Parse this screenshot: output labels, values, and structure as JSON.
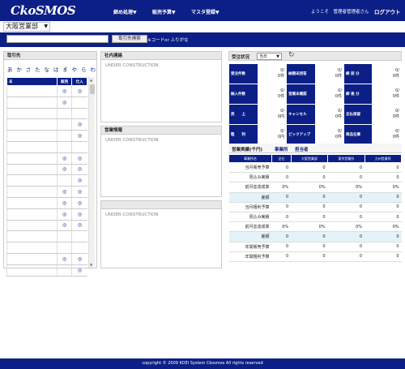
{
  "header": {
    "logo": "CkoSMOS",
    "menus": [
      "締め処理▼",
      "販売予算▼",
      "マスタ登録▼"
    ],
    "welcome": "ようこそ　管理者管理者さん",
    "logout": "ログアウト"
  },
  "office": {
    "selected": "大阪営業部",
    "arrow": "▼"
  },
  "search": {
    "input_value": "",
    "button": "取引先検索",
    "hint": "※コードor ふりがな"
  },
  "clients": {
    "title": "取引先",
    "kana": [
      "あ",
      "か",
      "さ",
      "た",
      "な",
      "は",
      "ま",
      "や",
      "ら",
      "わ"
    ],
    "columns": [
      "あ",
      "販売",
      "仕入"
    ],
    "mark": "◎",
    "rows": [
      {
        "sell": true,
        "buy": true
      },
      {
        "sell": true,
        "buy": false
      },
      {
        "sell": false,
        "buy": false
      },
      {
        "sell": false,
        "buy": true
      },
      {
        "sell": false,
        "buy": true
      },
      {
        "sell": false,
        "buy": false
      },
      {
        "sell": true,
        "buy": true
      },
      {
        "sell": true,
        "buy": true
      },
      {
        "sell": false,
        "buy": true
      },
      {
        "sell": true,
        "buy": true
      },
      {
        "sell": true,
        "buy": true
      },
      {
        "sell": true,
        "buy": true
      },
      {
        "sell": true,
        "buy": true
      },
      {
        "sell": false,
        "buy": false
      },
      {
        "sell": false,
        "buy": false
      },
      {
        "sell": true,
        "buy": true
      },
      {
        "sell": false,
        "buy": true
      }
    ]
  },
  "internal_notice": {
    "title": "社内連絡",
    "body": "UNDER CONSTRUCTION"
  },
  "sales_info": {
    "title": "営業情報",
    "body": "UNDER CONSTRUCTION"
  },
  "bottom_panel": {
    "title": "",
    "body": "UNDER CONSTRUCTION"
  },
  "orders": {
    "title": "受注状況",
    "period": "当日",
    "period_arrow": "▼",
    "cells": [
      [
        {
          "label": "受注件数",
          "value": "0/\n0件"
        },
        {
          "label": "納期未回答",
          "value": "0/\n0件"
        },
        {
          "label": "締 前 分",
          "value": "0/\n0件"
        }
      ],
      [
        {
          "label": "納入件数",
          "value": "0/\n0件"
        },
        {
          "label": "営業未確認",
          "value": "0/\n0件"
        },
        {
          "label": "締 後 分",
          "value": "0/\n0件"
        }
      ],
      [
        {
          "label": "売　　上",
          "value": "0/\n0円"
        },
        {
          "label": "キャンセル",
          "value": "0/\n0件"
        },
        {
          "label": "支払保留",
          "value": "0/\n0件"
        }
      ],
      [
        {
          "label": "粗　　利",
          "value": "0/\n0円"
        },
        {
          "label": "ピックアップ",
          "value": "0/\n0件"
        },
        {
          "label": "商品在庫",
          "value": "0/\n0件"
        }
      ]
    ]
  },
  "sales": {
    "tabs": [
      "営業実績(千円)",
      "事業所",
      "担当者"
    ],
    "columns": [
      "事業所名",
      "全社",
      "大阪営業部",
      "東京営業所",
      "九州営業所"
    ],
    "rows": [
      {
        "label": "当月販売予算",
        "values": [
          "0",
          "0",
          "0",
          "0"
        ],
        "alt": false
      },
      {
        "label": "見込み実績",
        "values": [
          "0",
          "0",
          "0",
          "0"
        ],
        "alt": false
      },
      {
        "label": "前月迄達成率",
        "values": [
          "0%",
          "0%",
          "0%",
          "0%"
        ],
        "alt": false
      },
      {
        "label": "差額",
        "values": [
          "0",
          "0",
          "0",
          "0"
        ],
        "alt": true
      },
      {
        "label": "当月粗利予算",
        "values": [
          "0",
          "0",
          "0",
          "0"
        ],
        "alt": false
      },
      {
        "label": "見込み実績",
        "values": [
          "0",
          "0",
          "0",
          "0"
        ],
        "alt": false
      },
      {
        "label": "前月迄達成率",
        "values": [
          "0%",
          "0%",
          "0%",
          "0%"
        ],
        "alt": false
      },
      {
        "label": "差額",
        "values": [
          "0",
          "0",
          "0",
          "0"
        ],
        "alt": true
      },
      {
        "label": "年間販売予算",
        "values": [
          "0",
          "0",
          "0",
          "0"
        ],
        "alt": false
      },
      {
        "label": "年間粗利予算",
        "values": [
          "0",
          "0",
          "0",
          "0"
        ],
        "alt": false
      }
    ]
  },
  "footer": {
    "text": "copyright © 2009 KOEI System Ckosmos All rights reserved"
  }
}
